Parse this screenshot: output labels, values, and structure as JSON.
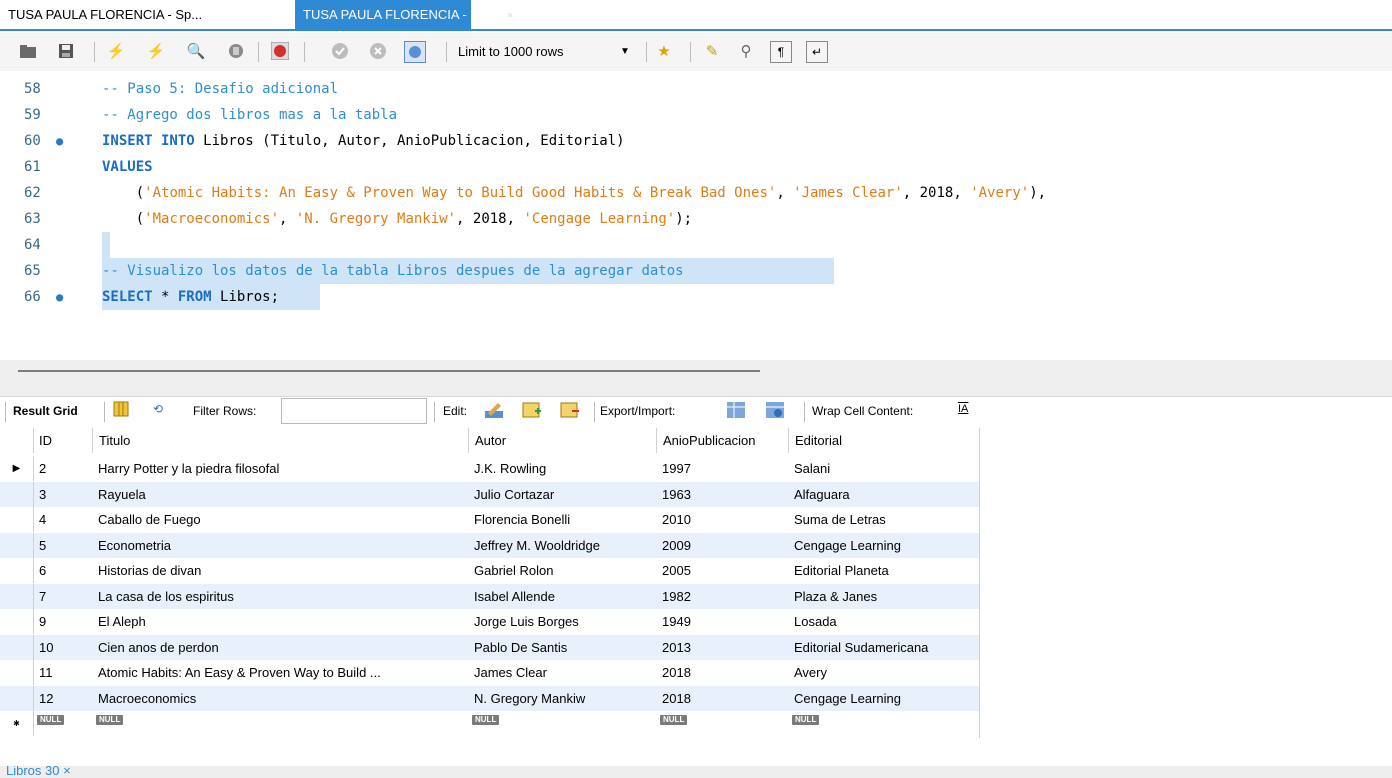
{
  "tabs": [
    {
      "label": "TUSA PAULA FLORENCIA - Sp...",
      "active": false
    },
    {
      "label": "TUSA PAULA FLORENCIA - Sp...",
      "active": true,
      "close": "×"
    }
  ],
  "toolbar": {
    "limit_label": "Limit to 1000 rows",
    "icons": [
      "open-folder-icon",
      "save-icon",
      "execute-icon",
      "execute-current-icon",
      "explain-icon",
      "stop-icon",
      "toggle-error-icon",
      "commit-icon",
      "rollback-icon",
      "autocommit-icon",
      "add-snippet-icon",
      "beautify-icon",
      "find-icon",
      "invisibles-icon",
      "wrap-icon"
    ]
  },
  "editor": {
    "lines": [
      {
        "num": "58",
        "dot": false,
        "html_parts": [
          {
            "cls": "cm",
            "text": "-- Paso 5: Desafio adicional"
          }
        ]
      },
      {
        "num": "59",
        "dot": false,
        "html_parts": [
          {
            "cls": "cm",
            "text": "-- Agrego dos libros mas a la tabla"
          }
        ]
      },
      {
        "num": "60",
        "dot": true,
        "html_parts": [
          {
            "cls": "kw",
            "text": "INSERT INTO"
          },
          {
            "cls": "",
            "text": " Libros (Titulo, Autor, AnioPublicacion, Editorial)"
          }
        ]
      },
      {
        "num": "61",
        "dot": false,
        "html_parts": [
          {
            "cls": "kw",
            "text": "VALUES"
          }
        ]
      },
      {
        "num": "62",
        "dot": false,
        "html_parts": [
          {
            "cls": "",
            "text": "    ("
          },
          {
            "cls": "str",
            "text": "'Atomic Habits: An Easy & Proven Way to Build Good Habits & Break Bad Ones'"
          },
          {
            "cls": "",
            "text": ", "
          },
          {
            "cls": "str",
            "text": "'James Clear'"
          },
          {
            "cls": "",
            "text": ", 2018, "
          },
          {
            "cls": "str",
            "text": "'Avery'"
          },
          {
            "cls": "",
            "text": "),"
          }
        ]
      },
      {
        "num": "63",
        "dot": false,
        "html_parts": [
          {
            "cls": "",
            "text": "    ("
          },
          {
            "cls": "str",
            "text": "'Macroeconomics'"
          },
          {
            "cls": "",
            "text": ", "
          },
          {
            "cls": "str",
            "text": "'N. Gregory Mankiw'"
          },
          {
            "cls": "",
            "text": ", 2018, "
          },
          {
            "cls": "str",
            "text": "'Cengage Learning'"
          },
          {
            "cls": "",
            "text": ");"
          }
        ]
      },
      {
        "num": "64",
        "dot": false,
        "html_parts": [
          {
            "cls": "",
            "text": ""
          }
        ]
      },
      {
        "num": "65",
        "dot": false,
        "html_parts": [
          {
            "cls": "cm",
            "text": "-- Visualizo los datos de la tabla Libros despues de la agregar datos"
          }
        ]
      },
      {
        "num": "66",
        "dot": true,
        "html_parts": [
          {
            "cls": "kw",
            "text": "SELECT"
          },
          {
            "cls": "",
            "text": " * "
          },
          {
            "cls": "kw",
            "text": "FROM"
          },
          {
            "cls": "",
            "text": " Libros;"
          }
        ]
      }
    ]
  },
  "results_toolbar": {
    "result_grid": "Result Grid",
    "filter_rows": "Filter Rows:",
    "edit": "Edit:",
    "export_import": "Export/Import:",
    "wrap": "Wrap Cell Content:"
  },
  "grid": {
    "columns": [
      "ID",
      "Titulo",
      "Autor",
      "AnioPublicacion",
      "Editorial"
    ],
    "rows": [
      [
        "2",
        "Harry Potter y la piedra filosofal",
        "J.K. Rowling",
        "1997",
        "Salani"
      ],
      [
        "3",
        "Rayuela",
        "Julio Cortazar",
        "1963",
        "Alfaguara"
      ],
      [
        "4",
        "Caballo de Fuego",
        "Florencia Bonelli",
        "2010",
        "Suma de Letras"
      ],
      [
        "5",
        "Econometria",
        "Jeffrey M. Wooldridge",
        "2009",
        "Cengage Learning"
      ],
      [
        "6",
        "Historias de divan",
        "Gabriel Rolon",
        "2005",
        "Editorial Planeta"
      ],
      [
        "7",
        "La casa de los espiritus",
        "Isabel Allende",
        "1982",
        "Plaza & Janes"
      ],
      [
        "9",
        "El Aleph",
        "Jorge Luis Borges",
        "1949",
        "Losada"
      ],
      [
        "10",
        "Cien anos de perdon",
        "Pablo De Santis",
        "2013",
        "Editorial Sudamericana"
      ],
      [
        "11",
        "Atomic Habits: An Easy & Proven Way to Build ...",
        "James Clear",
        "2018",
        "Avery"
      ],
      [
        "12",
        "Macroeconomics",
        "N. Gregory Mankiw",
        "2018",
        "Cengage Learning"
      ]
    ],
    "null_label": "NULL"
  },
  "bottom_tab": "Libros 30 ×"
}
